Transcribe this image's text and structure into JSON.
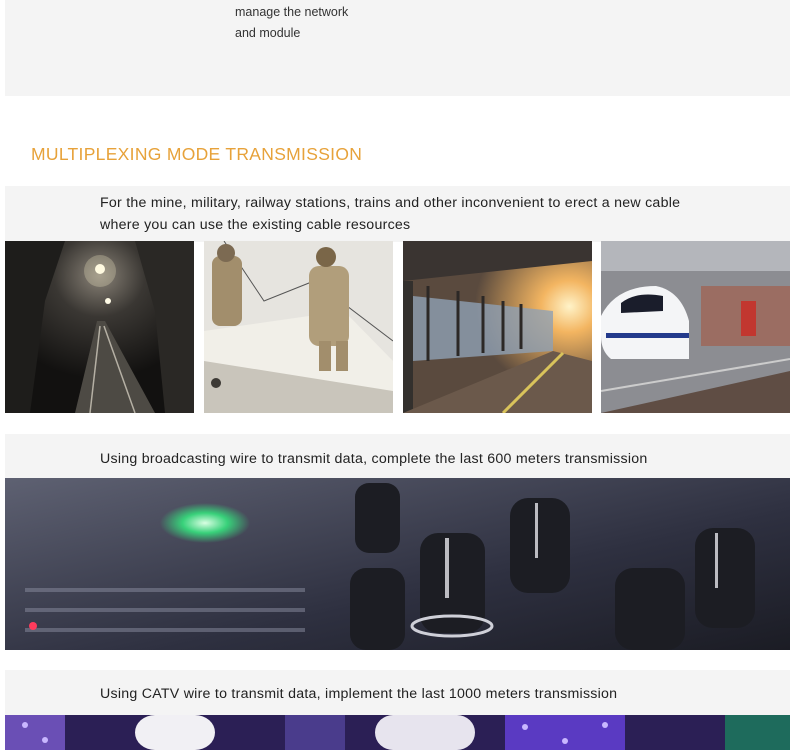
{
  "intro": {
    "line1": "manage the network",
    "line2": "and module"
  },
  "section": {
    "title": "MULTIPLEXING MODE TRANSMISSION"
  },
  "blocks": [
    {
      "line1": "For the mine, military, railway stations, trains and other inconvenient to erect a new cable",
      "line2": "where you can use the existing cable resources"
    },
    {
      "line1": "Using broadcasting wire to transmit data, complete the last 600 meters transmission"
    },
    {
      "line1": "Using CATV wire to transmit data, implement the last 1000 meters transmission"
    }
  ]
}
